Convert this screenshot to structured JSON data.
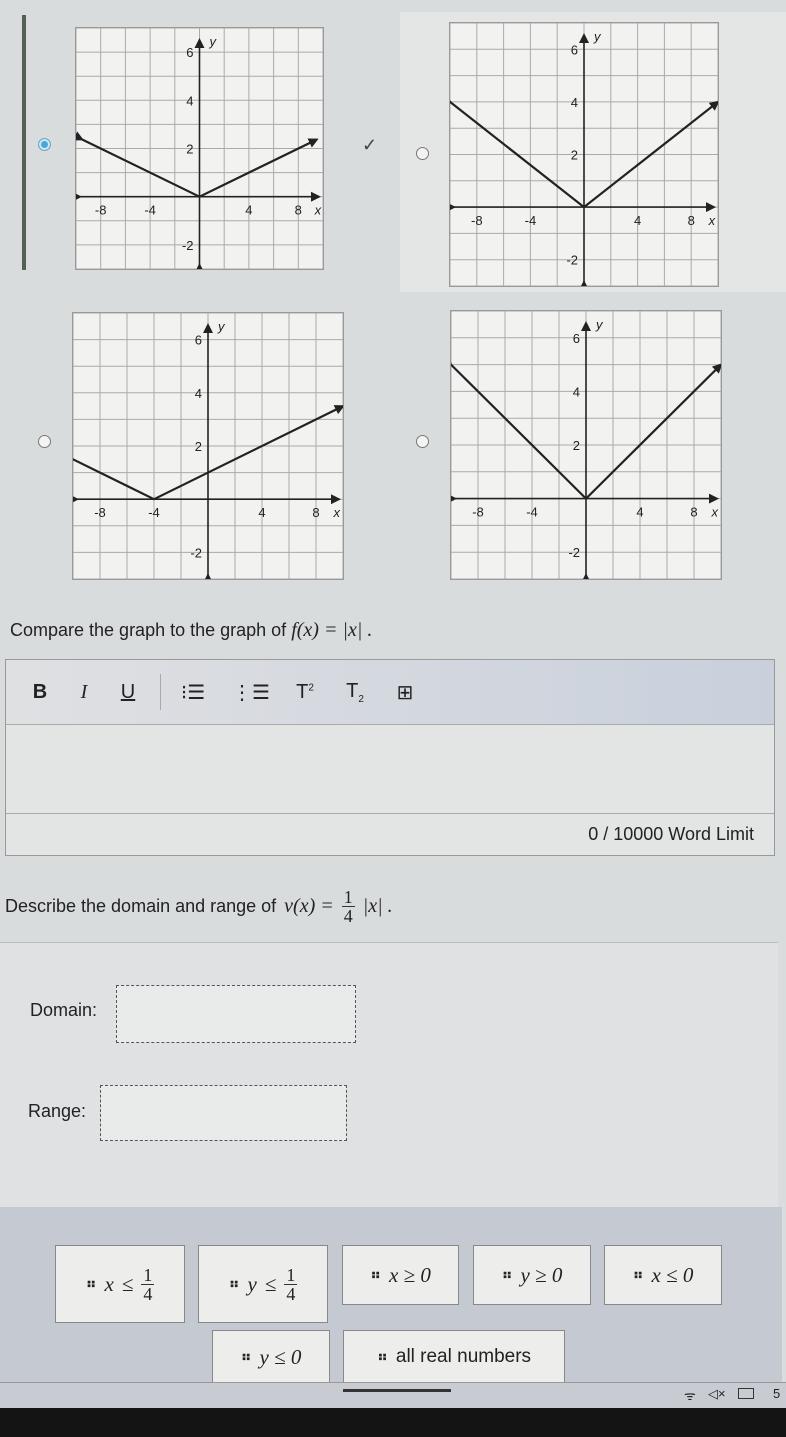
{
  "question1": {
    "options": [
      {
        "id": "A",
        "selected": true,
        "correct_mark": true,
        "points": [
          [
            -9.5,
            2.375
          ],
          [
            0,
            0
          ],
          [
            9.5,
            2.375
          ]
        ]
      },
      {
        "id": "B",
        "selected": false,
        "points": [
          [
            -10,
            4
          ],
          [
            0,
            0
          ],
          [
            10,
            4
          ]
        ]
      },
      {
        "id": "C",
        "selected": false,
        "points": [
          [
            -10,
            1.5
          ],
          [
            -4,
            0
          ],
          [
            10,
            3.5
          ]
        ]
      },
      {
        "id": "D",
        "selected": false,
        "points": [
          [
            -10,
            5
          ],
          [
            0,
            0
          ],
          [
            10,
            5
          ]
        ]
      }
    ],
    "axes": {
      "xlim": [
        -10,
        10
      ],
      "ylim": [
        -3,
        7
      ],
      "x_ticks": [
        "-8",
        "-4",
        "4",
        "8"
      ],
      "y_ticks": [
        "6",
        "4",
        "2",
        "-2"
      ],
      "xlabel": "x",
      "ylabel": "y"
    },
    "check_mark": "✓"
  },
  "question2": {
    "prompt": "Compare the graph to the graph of",
    "function": "f(x) = |x| .",
    "toolbar": [
      "B",
      "I",
      "U",
      "bulleted-list",
      "numbered-list",
      "superscript",
      "subscript",
      "table"
    ],
    "word_count": "0 / 10000 Word Limit"
  },
  "question3": {
    "prompt": "Describe the domain and range of",
    "function_left": "v(x) =",
    "function_num": "1",
    "function_den": "4",
    "function_right": "|x| .",
    "domain_label": "Domain:",
    "range_label": "Range:",
    "chips": [
      {
        "var": "x",
        "op": "≤",
        "num": "1",
        "den": "4"
      },
      {
        "var": "y",
        "op": "≤",
        "num": "1",
        "den": "4"
      },
      {
        "text": "x ≥ 0"
      },
      {
        "text": "y ≥ 0"
      },
      {
        "text": "x ≤ 0"
      },
      {
        "text": "y ≤ 0"
      },
      {
        "text": "all real numbers"
      }
    ]
  },
  "taskbar": {
    "icons": [
      "wifi-icon",
      "mute-icon",
      "battery-icon"
    ],
    "clock": "5"
  }
}
